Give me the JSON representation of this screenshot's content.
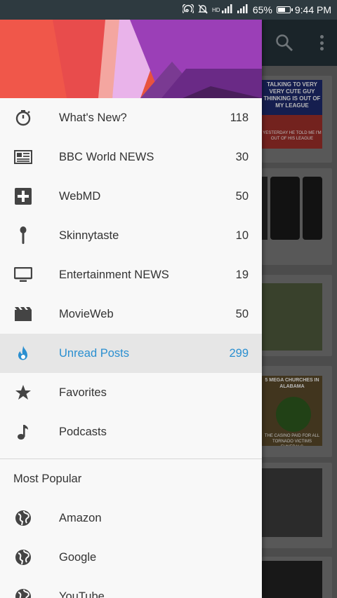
{
  "status_bar": {
    "battery": "65%",
    "time": "9:44 PM",
    "battery_level": 0.65
  },
  "drawer": {
    "items": [
      {
        "label": "What's New?",
        "count": "118",
        "icon": "stopwatch-icon"
      },
      {
        "label": "BBC World NEWS",
        "count": "30",
        "icon": "newspaper-icon"
      },
      {
        "label": "WebMD",
        "count": "50",
        "icon": "medical-cross-icon"
      },
      {
        "label": "Skinnytaste",
        "count": "10",
        "icon": "spoon-icon"
      },
      {
        "label": "Entertainment NEWS",
        "count": "19",
        "icon": "monitor-icon"
      },
      {
        "label": "MovieWeb",
        "count": "50",
        "icon": "clapperboard-icon"
      },
      {
        "label": "Unread Posts",
        "count": "299",
        "icon": "flame-icon",
        "active": true
      },
      {
        "label": "Favorites",
        "count": "",
        "icon": "star-icon"
      },
      {
        "label": "Podcasts",
        "count": "",
        "icon": "music-note-icon"
      }
    ],
    "section_title": "Most Popular",
    "popular": [
      {
        "label": "Amazon",
        "icon": "globe-icon"
      },
      {
        "label": "Google",
        "icon": "globe-icon"
      },
      {
        "label": "YouTube",
        "icon": "globe-icon"
      }
    ]
  },
  "background_content": {
    "meme1_top": "TALKING TO VERY VERY CUTE GUY THINKING IS OUT OF MY LEAGUE",
    "meme1_bottom": "YESTERDAY HE TOLD ME I'M OUT OF HIS LEAGUE",
    "meme2_top": "5 MEGA CHURCHES IN ALABAMA",
    "meme2_bottom": "THE CASINO PAID FOR ALL TORNADO VICTIMS FUNERALS"
  },
  "colors": {
    "accent": "#2a8fd0",
    "toolbar": "#25323a",
    "status_bar": "#2e3a40"
  }
}
